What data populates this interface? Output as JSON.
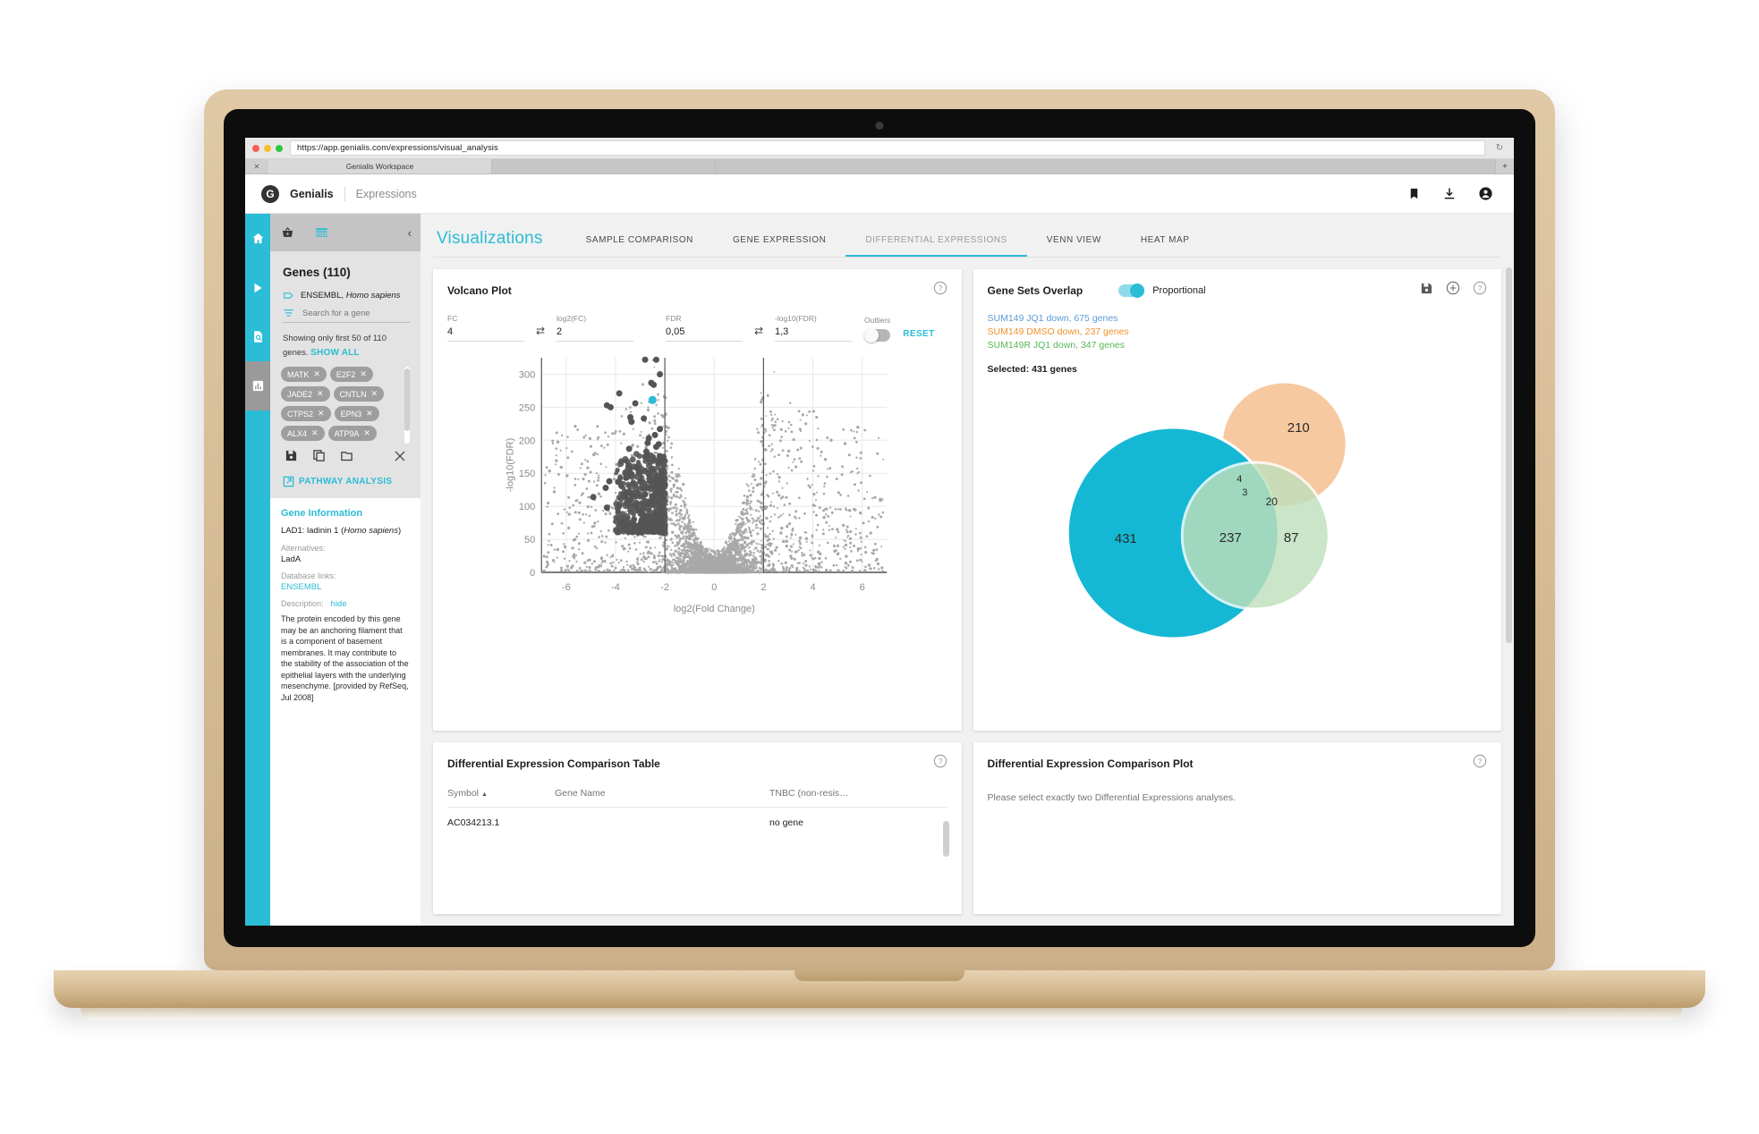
{
  "browser": {
    "url": "https://app.genialis.com/expressions/visual_analysis",
    "tab_title": "Genialis Workspace",
    "reload_icon": "reload-icon",
    "close_icon": "close-icon",
    "new_tab_label": "+"
  },
  "header": {
    "logo_letter": "G",
    "brand": "Genialis",
    "section": "Expressions",
    "icons": [
      "bookmark-icon",
      "download-icon",
      "account-icon"
    ]
  },
  "rail": {
    "items": [
      {
        "name": "home-icon",
        "active": true
      },
      {
        "name": "play-icon",
        "active": true
      },
      {
        "name": "data-search-icon",
        "active": true
      },
      {
        "name": "chart-icon",
        "active": false
      }
    ]
  },
  "panel": {
    "tabs": [
      {
        "name": "basket-icon",
        "selected": false
      },
      {
        "name": "table-icon",
        "selected": true
      }
    ],
    "collapse_icon": "chevron-left-icon",
    "title": "Genes (110)",
    "source": "ENSEMBL, ",
    "source_italic": "Homo sapiens",
    "search_placeholder": "Search for a gene",
    "showing_text": "Showing only first 50 of 110 genes.",
    "show_all_label": "SHOW ALL",
    "chips": [
      "MATK",
      "E2F2",
      "JADE2",
      "CNTLN",
      "CTPS2",
      "EPN3",
      "ALX4",
      "ATP9A"
    ],
    "chip_remove_glyph": "✕",
    "tools": [
      "save-icon",
      "copy-icon",
      "folder-icon",
      "clear-icon"
    ],
    "pathway_label": "PATHWAY ANALYSIS"
  },
  "gene_information": {
    "title": "Gene Information",
    "name_prefix": "LAD1: ladinin 1 (",
    "name_italic": "Homo sapiens",
    "name_suffix": ")",
    "alternatives_label": "Alternatives:",
    "alternatives_value": "LadA",
    "db_label": "Database links:",
    "db_value": "ENSEMBL",
    "description_label": "Description:",
    "description_toggle": "hide",
    "description": "The protein encoded by this gene may be an anchoring filament that is a component of basement membranes. It may contribute to the stability of the association of the epithelial layers with the underlying mesenchyme. [provided by RefSeq, Jul 2008]"
  },
  "visualizations": {
    "title": "Visualizations",
    "tabs": [
      {
        "label": "SAMPLE COMPARISON",
        "active": false
      },
      {
        "label": "GENE EXPRESSION",
        "active": false
      },
      {
        "label": "DIFFERENTIAL EXPRESSIONS",
        "active": true
      },
      {
        "label": "VENN VIEW",
        "active": false
      },
      {
        "label": "HEAT MAP",
        "active": false
      }
    ]
  },
  "volcano_card": {
    "title": "Volcano Plot",
    "help_icon": "help-icon",
    "controls": [
      {
        "label": "FC",
        "value": "4"
      },
      {
        "label": "log2(FC)",
        "value": "2"
      },
      {
        "label": "FDR",
        "value": "0,05"
      },
      {
        "label": "-log10(FDR)",
        "value": "1,3"
      }
    ],
    "swap_glyph": "⇄",
    "outliers_label": "Outliers",
    "outliers_on": false,
    "reset_label": "RESET"
  },
  "gene_sets_card": {
    "title": "Gene Sets Overlap",
    "proportional_label": "Proportional",
    "proportional_on": true,
    "icons": [
      "save-icon",
      "add-icon",
      "help-icon"
    ],
    "selected_line": "Selected: 431 genes"
  },
  "table_card": {
    "title": "Differential Expression Comparison Table",
    "help_icon": "help-icon",
    "columns": [
      "Symbol",
      "Gene Name",
      "TNBC (non-resis…"
    ],
    "sort_glyph": "▲",
    "rows": [
      {
        "symbol": "AC034213.1",
        "gene_name": "",
        "tnbc": "no gene"
      }
    ]
  },
  "de_plot_card": {
    "title": "Differential Expression Comparison Plot",
    "help_icon": "help-icon",
    "message": "Please select exactly two Differential Expressions analyses."
  },
  "colors": {
    "accent": "#2bbcd6",
    "venn_blue": "#15b8d4",
    "venn_orange": "#fbd6b0",
    "venn_green": "#c5e3c4",
    "legend_blue": "#5b9bd5",
    "legend_orange": "#f0922a",
    "legend_green": "#57b657",
    "volcano_dark": "#555555",
    "volcano_light": "#a8a8a8",
    "volcano_highlight": "#2bbcd6"
  },
  "chart_data": [
    {
      "type": "scatter",
      "name": "volcano-plot",
      "title": "Volcano Plot",
      "xlabel": "log2(Fold Change)",
      "ylabel": "-log10(FDR)",
      "xlim": [
        -7,
        7
      ],
      "ylim": [
        0,
        325
      ],
      "xticks": [
        -6,
        -4,
        -2,
        0,
        2,
        4,
        6
      ],
      "yticks": [
        0,
        50,
        100,
        150,
        200,
        250,
        300
      ],
      "grid": true,
      "threshold_lines_x": [
        -2,
        2
      ],
      "threshold_log2fc": 2,
      "threshold_neglog10fdr": 1.3,
      "series": [
        {
          "name": "selected (dark)",
          "color": "#555555",
          "points": [
            [
              -2.8,
              322
            ],
            [
              -2.35,
              322
            ],
            [
              -2.2,
              300
            ],
            [
              -2.55,
              287
            ],
            [
              -2.45,
              284
            ],
            [
              -3.85,
              271
            ],
            [
              -2.5,
              261
            ],
            [
              -3.2,
              256
            ],
            [
              -4.35,
              253
            ],
            [
              -4.2,
              250
            ],
            [
              -3.4,
              235
            ],
            [
              -3.35,
              228
            ],
            [
              -2.85,
              233
            ],
            [
              -2.2,
              217
            ],
            [
              -2.4,
              208
            ],
            [
              -2.65,
              203
            ],
            [
              -2.7,
              196
            ],
            [
              -2.25,
              194
            ],
            [
              -2.35,
              190
            ],
            [
              -3.45,
              187
            ],
            [
              -2.75,
              183
            ],
            [
              -2.8,
              175
            ],
            [
              -2.2,
              176
            ],
            [
              -2.15,
              152
            ],
            [
              -3.6,
              150
            ],
            [
              -3.35,
              149
            ],
            [
              -2.3,
              146
            ],
            [
              -4.25,
              138
            ],
            [
              -3.9,
              137
            ],
            [
              -2.6,
              138
            ],
            [
              -4.4,
              128
            ],
            [
              -2.5,
              130
            ],
            [
              -3.6,
              114
            ],
            [
              -4.9,
              114
            ],
            [
              -2.8,
              118
            ],
            [
              -3.4,
              110
            ],
            [
              -2.4,
              112
            ],
            [
              -4.35,
              98
            ],
            [
              -3.05,
              95
            ],
            [
              -2.9,
              88
            ],
            [
              -2.6,
              84
            ],
            [
              -3.25,
              80
            ],
            [
              -2.9,
              76
            ],
            [
              -3.4,
              74
            ],
            [
              -2.55,
              72
            ]
          ]
        },
        {
          "name": "highlighted gene",
          "color": "#2bbcd6",
          "points": [
            [
              -2.5,
              261
            ]
          ]
        },
        {
          "name": "background (light)",
          "color": "#a8a8a8",
          "description": "dense cloud of non-significant genes centered near log2FC 0"
        }
      ]
    },
    {
      "type": "venn",
      "name": "gene-sets-overlap",
      "title": "Gene Sets Overlap",
      "proportional": true,
      "sets": [
        {
          "label": "SUM149 JQ1 down",
          "total": 675,
          "total_label": "SUM149 JQ1 down, 675 genes",
          "color": "#15b8d4"
        },
        {
          "label": "SUM149 DMSO down",
          "total": 237,
          "total_label": "SUM149 DMSO down, 237 genes",
          "color": "#f7c9a0"
        },
        {
          "label": "SUM149R JQ1 down",
          "total": 347,
          "total_label": "SUM149R JQ1 down, 347 genes",
          "color": "#bfe0bb"
        }
      ],
      "regions": [
        {
          "id": "A_only",
          "label": "431",
          "value": 431
        },
        {
          "id": "B_only",
          "label": "210",
          "value": 210
        },
        {
          "id": "C_only",
          "label": "87",
          "value": 87
        },
        {
          "id": "A_B",
          "label": "4",
          "value": 4
        },
        {
          "id": "A_B_C",
          "label": "3",
          "value": 3
        },
        {
          "id": "B_C",
          "label": "20",
          "value": 20
        },
        {
          "id": "A_C",
          "label": "237",
          "value": 237
        }
      ],
      "selected": "Selected: 431 genes"
    }
  ]
}
